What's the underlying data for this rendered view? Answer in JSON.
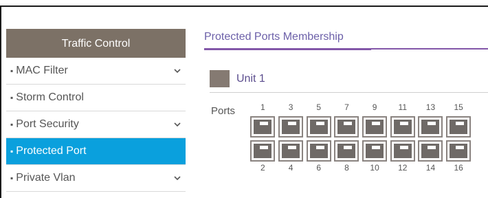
{
  "sidebar": {
    "header": "Traffic Control",
    "items": [
      {
        "label": "MAC Filter",
        "has_chevron": true,
        "active": false
      },
      {
        "label": "Storm Control",
        "has_chevron": false,
        "active": false
      },
      {
        "label": "Port Security",
        "has_chevron": true,
        "active": false
      },
      {
        "label": "Protected Port",
        "has_chevron": false,
        "active": true
      },
      {
        "label": "Private Vlan",
        "has_chevron": true,
        "active": false
      }
    ]
  },
  "main": {
    "title": "Protected Ports Membership",
    "unit_label": "Unit 1",
    "ports_label": "Ports",
    "top_numbers": [
      "1",
      "3",
      "5",
      "7",
      "9",
      "11",
      "13",
      "15"
    ],
    "bottom_numbers": [
      "2",
      "4",
      "6",
      "8",
      "10",
      "12",
      "14",
      "16"
    ]
  },
  "colors": {
    "header_bg": "#7c7166",
    "active_bg": "#0aa0dd",
    "accent": "#8256a8",
    "port_fill": "#6f6a67"
  }
}
